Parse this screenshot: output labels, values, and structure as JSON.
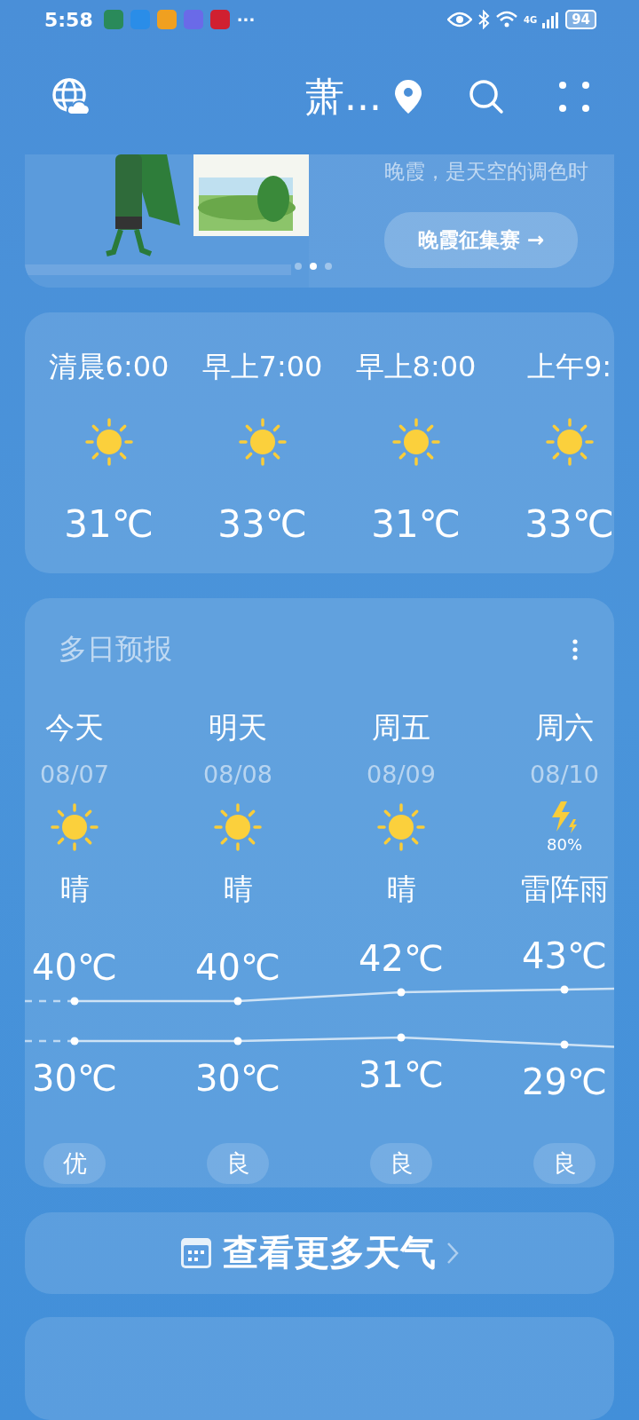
{
  "status_bar": {
    "time": "5:58",
    "more": "···",
    "network": "4G",
    "battery": "94"
  },
  "header": {
    "city": "萧..."
  },
  "banner": {
    "kind": "picture",
    "caption": "晚霞，是天空的调色时",
    "button": "晚霞征集赛 →",
    "dots": [
      {
        "selected": false
      },
      {
        "selected": true
      },
      {
        "selected": false
      }
    ]
  },
  "hourly": [
    {
      "time": "清晨6:00",
      "kind": "sunny",
      "temp": "31℃"
    },
    {
      "time": "早上7:00",
      "kind": "sunny",
      "temp": "33℃"
    },
    {
      "time": "早上8:00",
      "kind": "sunny",
      "temp": "31℃"
    },
    {
      "time": "上午9:",
      "kind": "sunny",
      "temp": "33℃"
    }
  ],
  "forecast": {
    "title": "多日预报",
    "days": [
      {
        "day": "今天",
        "date": "08/07",
        "kind": "sunny",
        "weather": "晴",
        "high": "40℃",
        "low": "30℃",
        "aqi": "优"
      },
      {
        "day": "明天",
        "date": "08/08",
        "kind": "sunny",
        "weather": "晴",
        "high": "40℃",
        "low": "30℃",
        "aqi": "良"
      },
      {
        "day": "周五",
        "date": "08/09",
        "kind": "sunny",
        "weather": "晴",
        "high": "42℃",
        "low": "31℃",
        "aqi": "良"
      },
      {
        "day": "周六",
        "date": "08/10",
        "kind": "thunder",
        "precip": "80%",
        "weather": "雷阵雨",
        "high": "43℃",
        "low": "29℃",
        "aqi": "良"
      }
    ]
  },
  "more_button": {
    "label": "查看更多天气"
  }
}
